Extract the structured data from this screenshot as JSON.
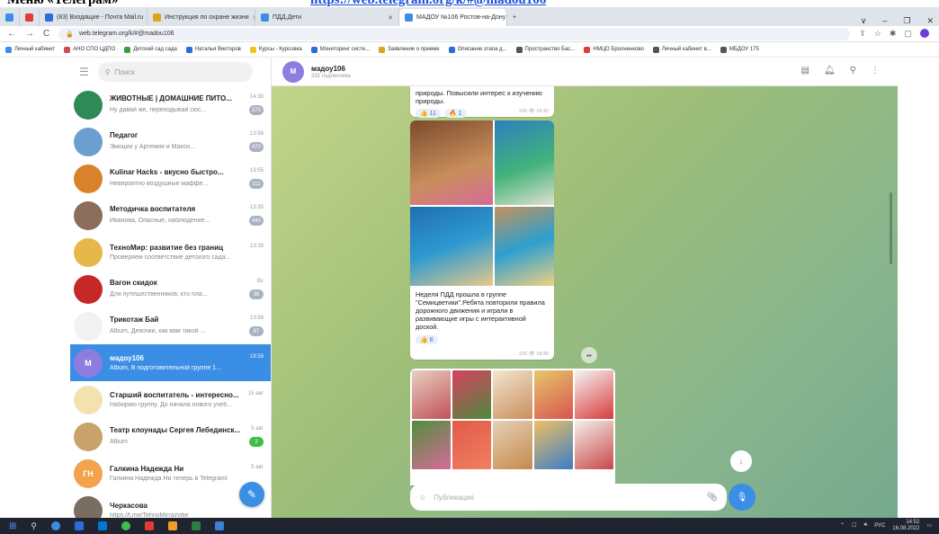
{
  "banner": {
    "heading": "Меню «Телеграм»",
    "link": "https://web.telegram.org/k/#@madou106"
  },
  "browser": {
    "tabs": [
      {
        "label": "(83) Входящие - Почта Mail.ru",
        "color": "#2a6dd8",
        "active": false
      },
      {
        "label": "Инструкция по охране жизни",
        "color": "#e0a21d",
        "active": false
      },
      {
        "label": "ПДД.Дети",
        "color": "#3b8ee6",
        "active": false
      },
      {
        "label": "МАДОУ №106 Ростов-на-Дону",
        "color": "#3b8ee6",
        "active": true
      }
    ],
    "url": "web.telegram.org/k/#@madou106",
    "window_controls": [
      "∨",
      "–",
      "❐",
      "✕"
    ],
    "bookmarks": [
      "Личный кабинет",
      "АНО СПО ЦДПО",
      "Детский сад сада",
      "Наталья Викторов",
      "Курсы - Курсовка",
      "Мониторинг систе...",
      "Заявление о приеме",
      "Описание этапа д...",
      "Пространство Бас...",
      "НМЦО Бролненково",
      "Личный кабинет в...",
      "МБДОУ 175"
    ]
  },
  "sidebar": {
    "search_placeholder": "Поиск",
    "chats": [
      {
        "title": "ЖИВОТНЫЕ | ДОМАШНИЕ ПИТО...",
        "time": "14:38",
        "preview": "Ну давай же, переходывай сюс...",
        "badge": "370",
        "avatar_color": "#2e8b57",
        "initials": "",
        "active": false,
        "badge_green": false
      },
      {
        "title": "Педагог",
        "time": "13:58",
        "preview": "Эмоции у Артемия и Макси...",
        "badge": "470",
        "avatar_color": "#6a9fd0",
        "initials": "",
        "active": false,
        "badge_green": false
      },
      {
        "title": "Kulinar Hacks - вкусно быстро...",
        "time": "13:55",
        "preview": "Невероятно воздушные маффе...",
        "badge": "112",
        "avatar_color": "#d9822b",
        "initials": "",
        "active": false,
        "badge_green": false
      },
      {
        "title": "Методичка воспитателя",
        "time": "13:35",
        "preview": "Иванова, Опасные, наблюдение...",
        "badge": "440",
        "avatar_color": "#8a6d5a",
        "initials": "",
        "active": false,
        "badge_green": false
      },
      {
        "title": "ТехноМир: развитие без границ",
        "time": "13:35",
        "preview": "Проверяем соответствие детского сада...",
        "badge": "",
        "avatar_color": "#e6b84a",
        "initials": "",
        "active": false,
        "badge_green": false
      },
      {
        "title": "Вагон скидок",
        "time": "Вс",
        "preview": "Для путешественников, кто пла...",
        "badge": "36",
        "avatar_color": "#c62828",
        "initials": "",
        "active": false,
        "badge_green": false
      },
      {
        "title": "Трикотаж Бай",
        "time": "13:58",
        "preview": "Album, Девочки, как вам такой ...",
        "badge": "87",
        "avatar_color": "#f2f2f2",
        "initials": "",
        "active": false,
        "badge_green": false
      },
      {
        "title": "мадоу106",
        "time": "18:58",
        "preview": "Album, В подготовительной группе 1...",
        "badge": "",
        "avatar_color": "#8e7de0",
        "initials": "M",
        "active": true,
        "badge_green": false
      },
      {
        "title": "Старший воспитатель - интересно...",
        "time": "15 авг",
        "preview": "Набираю группу. До начала нового учеб...",
        "badge": "",
        "avatar_color": "#f3e1b0",
        "initials": "",
        "active": false,
        "badge_green": false
      },
      {
        "title": "Театр клоунады Сергея Лебединск...",
        "time": "5 авг",
        "preview": "Album",
        "badge": "2",
        "avatar_color": "#c9a36b",
        "initials": "",
        "active": false,
        "badge_green": true
      },
      {
        "title": "Галкина Надежда Ни",
        "time": "5 авг",
        "preview": "Галкина Надежда Ни теперь в Telegram!",
        "badge": "",
        "avatar_color": "#f2a34b",
        "initials": "ГН",
        "active": false,
        "badge_green": false
      },
      {
        "title": "Черкасова",
        "time": "",
        "preview": "https://t.me/TehnoMirrazvitie",
        "badge": "",
        "avatar_color": "#7a6d62",
        "initials": "",
        "active": false,
        "badge_green": false
      }
    ]
  },
  "channel": {
    "name": "мадоу106",
    "subscribers": "332 подписчика",
    "initial": "M"
  },
  "messages": {
    "m1_text": "природы. Повысили интерес к изучению природы.",
    "m1_react_like": "👍 11",
    "m1_react_fire": "🔥 1",
    "m1_meta": "226 👁 18:42",
    "m2_caption": "Неделя ПДД прошла в группе \"Семицветики\".Ребята повторили правила дорожного движения и играли в развивающие игры с интерактивной доской.",
    "m2_react_like": "👍 8",
    "m2_meta": "226 👁 18:45"
  },
  "composer": {
    "placeholder": "Публикация"
  },
  "taskbar": {
    "time": "14:52",
    "date": "16.08.2022",
    "lang": "РУС"
  }
}
